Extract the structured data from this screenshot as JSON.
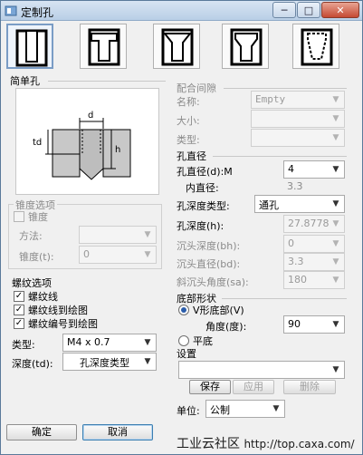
{
  "window": {
    "title": "定制孔"
  },
  "simple_hole": {
    "label": "简单孔",
    "diagram_labels": {
      "d": "d",
      "td": "td",
      "h": "h"
    }
  },
  "taper_options": {
    "label": "锥度选项",
    "taper_checkbox": {
      "label": "锥度",
      "checked": false
    },
    "method_label": "方法:",
    "method_value": "",
    "taper_t_label": "锥度(t):",
    "taper_t_value": "0"
  },
  "thread_options": {
    "label": "螺纹选项",
    "thread_line": {
      "label": "螺纹线",
      "checked": true
    },
    "thread_to_drawing": {
      "label": "螺纹线到绘图",
      "checked": true
    },
    "thread_num_to_drawing": {
      "label": "螺纹编号到绘图",
      "checked": true
    },
    "type_label": "类型:",
    "type_value": "M4 x 0.7",
    "depth_label": "深度(td):",
    "depth_value": "孔深度类型"
  },
  "fit_clearance": {
    "label": "配合间隙",
    "name_label": "名称:",
    "name_value": "Empty",
    "size_label": "大小:",
    "size_value": "",
    "type_label": "类型:",
    "type_value": ""
  },
  "hole_diameter": {
    "label": "孔直径",
    "diameter_label": "孔直径(d):M",
    "diameter_value": "4",
    "inner_label": "内直径:",
    "inner_value": "3.3",
    "depth_type_label": "孔深度类型:",
    "depth_type_value": "通孔",
    "depth_label": "孔深度(h):",
    "depth_value": "27.8778",
    "sink_depth_label": "沉头深度(bh):",
    "sink_depth_value": "0",
    "sink_diam_label": "沉头直径(bd):",
    "sink_diam_value": "3.3",
    "chamfer_angle_label": "斜沉头角度(sa):",
    "chamfer_angle_value": "180"
  },
  "bottom_shape": {
    "label": "底部形状",
    "v_bottom": "V形底部(V)",
    "angle_label": "角度(度):",
    "angle_value": "90",
    "flat_bottom": "平底"
  },
  "settings": {
    "label": "设置",
    "value": "",
    "save": "保存",
    "apply": "应用",
    "delete": "删除"
  },
  "unit": {
    "label": "单位:",
    "value": "公制"
  },
  "buttons": {
    "ok": "确定",
    "cancel": "取消"
  },
  "watermark": {
    "text": "工业云社区",
    "url": "http://top.caxa.com/"
  },
  "icons": [
    "drill-hole-icon",
    "counterbore-icon",
    "countersink-icon",
    "counterdrill-icon",
    "tapered-hole-icon"
  ]
}
